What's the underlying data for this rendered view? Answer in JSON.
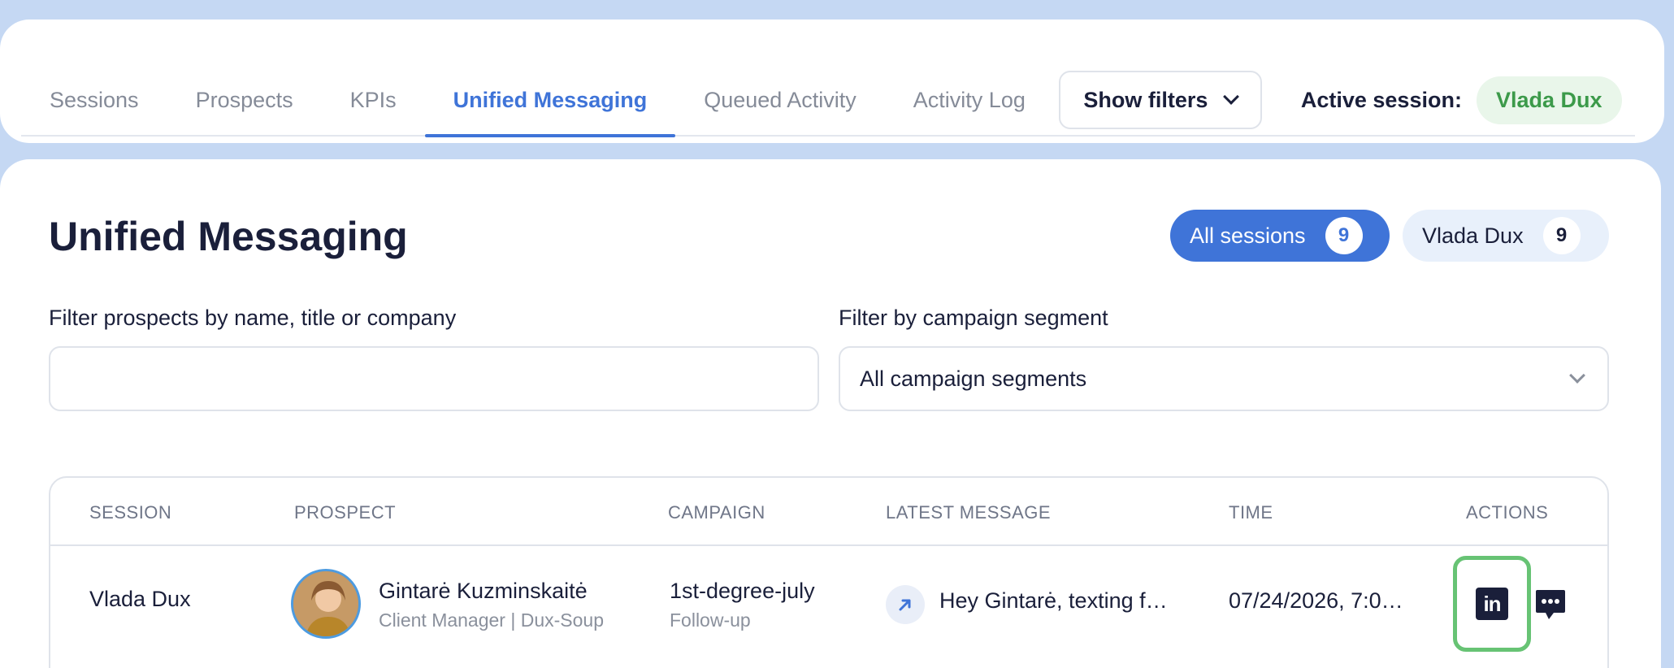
{
  "nav": {
    "tabs": [
      {
        "label": "Sessions"
      },
      {
        "label": "Prospects"
      },
      {
        "label": "KPIs"
      },
      {
        "label": "Unified Messaging"
      },
      {
        "label": "Queued Activity"
      },
      {
        "label": "Activity Log"
      }
    ],
    "active_tab": "Unified Messaging",
    "show_filters_label": "Show filters",
    "active_session_label": "Active session:",
    "active_session_value": "Vlada Dux"
  },
  "page": {
    "title": "Unified Messaging",
    "session_pills": [
      {
        "label": "All sessions",
        "count": "9"
      },
      {
        "label": "Vlada Dux",
        "count": "9"
      }
    ]
  },
  "filters": {
    "prospect_label": "Filter prospects by name, title or company",
    "prospect_value": "",
    "segment_label": "Filter by campaign segment",
    "segment_value": "All campaign segments"
  },
  "table": {
    "headers": [
      "SESSION",
      "PROSPECT",
      "CAMPAIGN",
      "LATEST MESSAGE",
      "TIME",
      "ACTIONS"
    ],
    "rows": [
      {
        "session": "Vlada Dux",
        "prospect_name": "Gintarė Kuzminskaitė",
        "prospect_title": "Client Manager | Dux-Soup",
        "campaign": "1st-degree-july",
        "campaign_step": "Follow-up",
        "latest_message": "Hey Gintarė, texting f…",
        "time": "07/24/2026, 7:0…"
      }
    ]
  },
  "colors": {
    "accent": "#3f74d8",
    "active_session_green": "#3c9a4a",
    "highlight_border": "#67c374"
  },
  "icons": {
    "dropdown": "chevron-down-icon",
    "message_direction": "arrow-up-right-icon",
    "linkedin": "linkedin-icon",
    "chat": "chat-bubble-icon"
  }
}
